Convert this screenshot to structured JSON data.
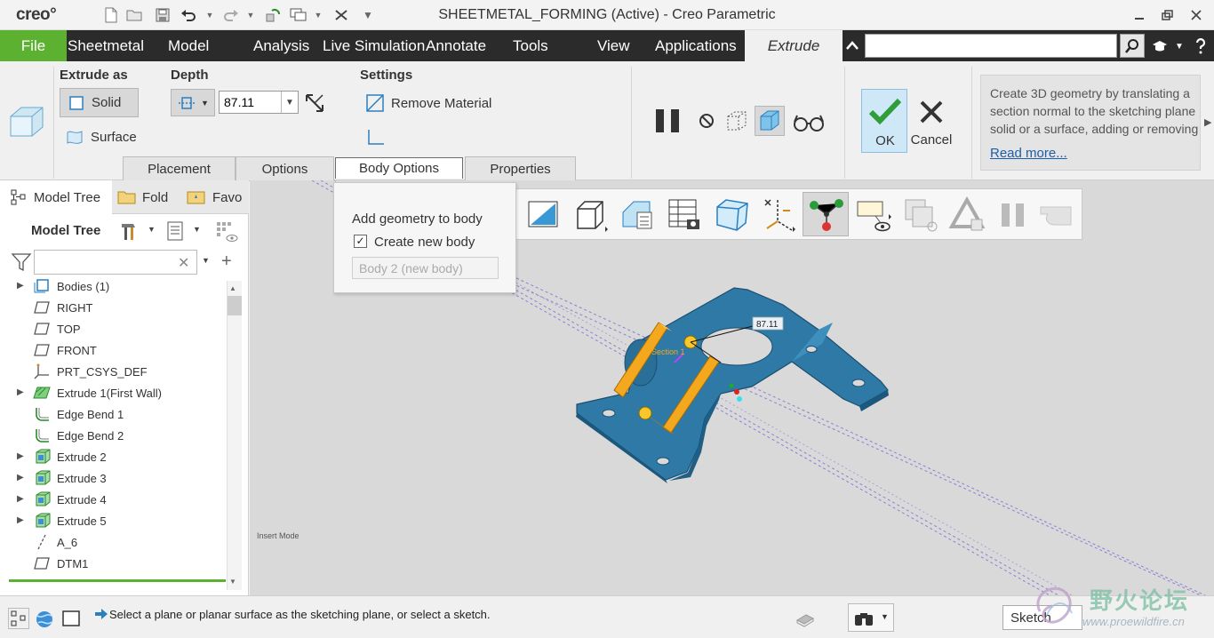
{
  "title_bar": {
    "logo": "creo°",
    "window_title": "SHEETMETAL_FORMING (Active) - Creo Parametric"
  },
  "menu": {
    "file": "File",
    "tabs": [
      "Sheetmetal",
      "Model",
      "Analysis",
      "Live Simulation",
      "Annotate",
      "Tools",
      "View",
      "Applications"
    ],
    "active_tab": "Extrude",
    "search_value": ""
  },
  "ribbon": {
    "extrude_as": {
      "label": "Extrude as",
      "solid": "Solid",
      "surface": "Surface"
    },
    "depth": {
      "label": "Depth",
      "value": "87.11"
    },
    "settings": {
      "label": "Settings",
      "remove_material": "Remove Material"
    },
    "ok": "OK",
    "cancel": "Cancel",
    "help_text": "Create 3D geometry by translating a\nsection normal to the sketching plane\nsolid or a surface, adding or removing",
    "read_more": "Read more...",
    "subtabs": [
      "Placement",
      "Options",
      "Body Options",
      "Properties"
    ]
  },
  "body_options_popup": {
    "title": "Add geometry to body",
    "checkbox_label": "Create new body",
    "checked": true,
    "body_field": "Body 2 (new body)"
  },
  "left_pane": {
    "tabs": [
      "Model Tree",
      "Fold",
      "Favo"
    ],
    "title": "Model Tree",
    "filter_value": "",
    "tree": [
      {
        "label": "Bodies (1)",
        "icon": "bodies-icon",
        "expandable": true
      },
      {
        "label": "RIGHT",
        "icon": "datum-plane-icon",
        "expandable": false
      },
      {
        "label": "TOP",
        "icon": "datum-plane-icon",
        "expandable": false
      },
      {
        "label": "FRONT",
        "icon": "datum-plane-icon",
        "expandable": false
      },
      {
        "label": "PRT_CSYS_DEF",
        "icon": "csys-icon",
        "expandable": false
      },
      {
        "label": "Extrude 1(First Wall)",
        "icon": "first-wall-icon",
        "expandable": true
      },
      {
        "label": "Edge Bend 1",
        "icon": "edge-bend-icon",
        "expandable": false
      },
      {
        "label": "Edge Bend 2",
        "icon": "edge-bend-icon",
        "expandable": false
      },
      {
        "label": "Extrude 2",
        "icon": "extrude-feature-icon",
        "expandable": true
      },
      {
        "label": "Extrude 3",
        "icon": "extrude-feature-icon",
        "expandable": true
      },
      {
        "label": "Extrude 4",
        "icon": "extrude-feature-icon",
        "expandable": true
      },
      {
        "label": "Extrude 5",
        "icon": "extrude-feature-icon",
        "expandable": true
      },
      {
        "label": "A_6",
        "icon": "datum-axis-icon",
        "expandable": false
      },
      {
        "label": "DTM1",
        "icon": "datum-plane-icon",
        "expandable": false
      }
    ]
  },
  "graphics": {
    "insert_mode": "Insert Mode",
    "dimension": "87.11",
    "section_label": "Section 1"
  },
  "status_bar": {
    "message": "Select a plane or planar surface as the sketching plane, or select a sketch.",
    "filter": "Sketch"
  },
  "watermark": {
    "text_cn": "野火论坛",
    "url": "www.proewildfire.cn"
  }
}
